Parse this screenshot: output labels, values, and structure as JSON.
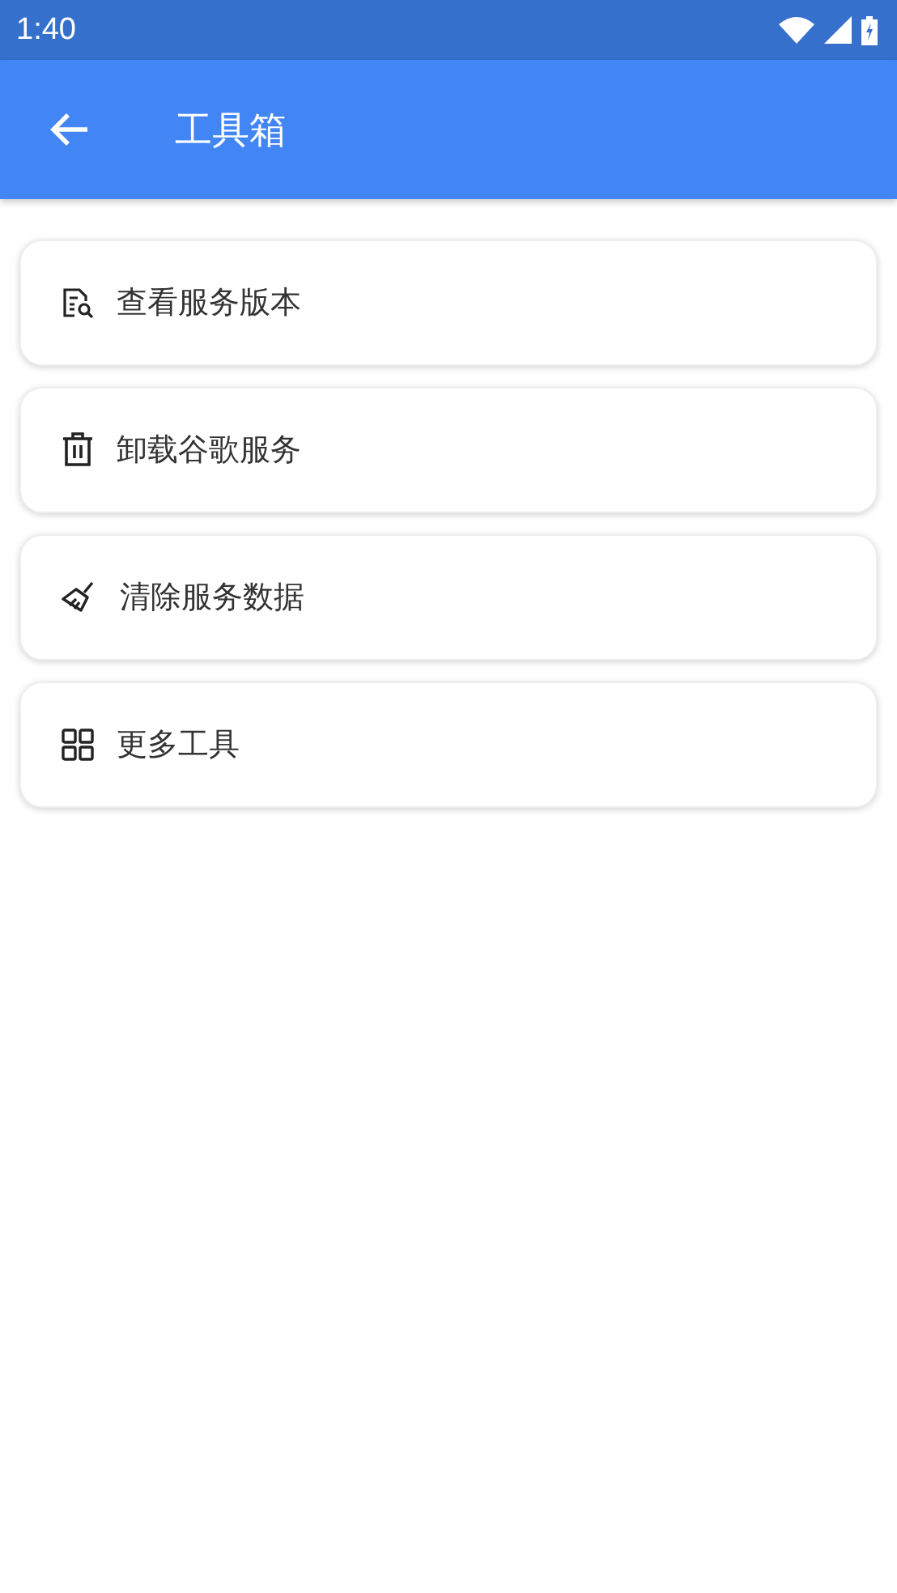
{
  "status_bar": {
    "time": "1:40"
  },
  "app_bar": {
    "title": "工具箱"
  },
  "items": [
    {
      "label": "查看服务版本"
    },
    {
      "label": "卸载谷歌服务"
    },
    {
      "label": "清除服务数据"
    },
    {
      "label": "更多工具"
    }
  ]
}
